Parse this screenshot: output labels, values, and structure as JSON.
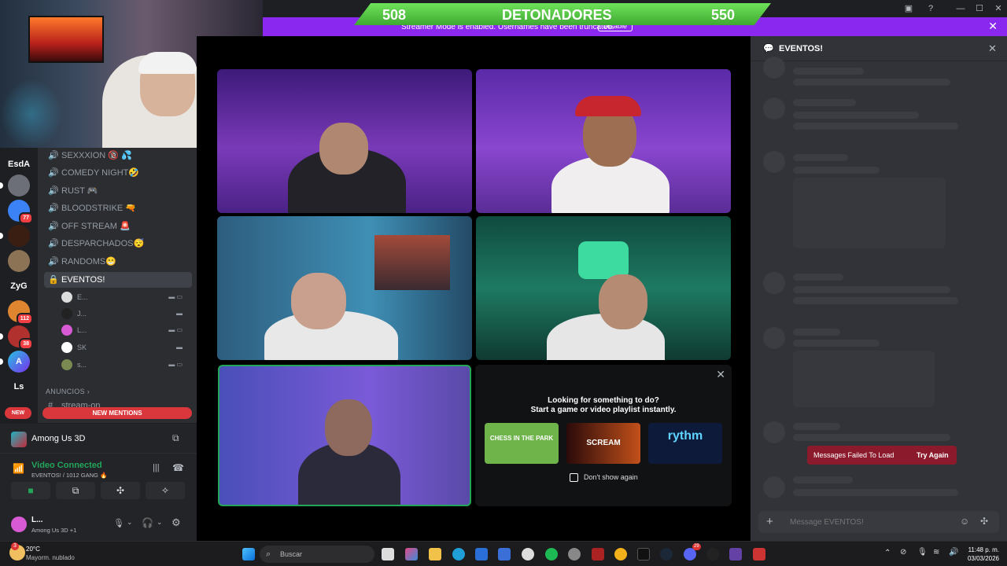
{
  "score": {
    "left": "508",
    "title": "DETONADORES",
    "right": "550"
  },
  "streamer_bar": {
    "message": "Streamer Mode is enabled. Usernames have been truncated.",
    "disable_label": "Disable"
  },
  "servers": [
    {
      "label": "EsdA"
    },
    {
      "label": "ZyG"
    },
    {
      "label": "Ls"
    }
  ],
  "server_badges": [
    "77",
    "112",
    "38"
  ],
  "channels": [
    {
      "name": "SEXXXION 🔞 💦"
    },
    {
      "name": "COMEDY NIGHT🤣"
    },
    {
      "name": "RUST 🎮"
    },
    {
      "name": "BLOODSTRIKE 🔫"
    },
    {
      "name": "OFF STREAM 🚨"
    },
    {
      "name": "DESPARCHADOS😴"
    },
    {
      "name": "RANDOMS😁"
    }
  ],
  "selected_channel": "EVENTOS!",
  "members": [
    "E...",
    "J...",
    "L...",
    "SK",
    "s..."
  ],
  "category": "ANUNCIOS",
  "next_channel_partial": "stream-on",
  "new_label": "NEW",
  "new_mentions": "NEW MENTIONS",
  "game_activity": "Among Us 3D",
  "voice": {
    "status": "Video Connected",
    "location": "EVENTOS! / 1012 GANG 🔥"
  },
  "user": {
    "name": "L...",
    "activity": "Among Us 3D +1"
  },
  "activity_panel": {
    "line1": "Looking for something to do?",
    "line2": "Start a game or video playlist instantly.",
    "dont_show": "Don't show again",
    "cards": [
      "CHESS IN THE PARK",
      "SCREAM",
      "rythm"
    ]
  },
  "chat": {
    "title": "EVENTOS!",
    "error": "Messages Failed To Load",
    "retry": "Try Again",
    "placeholder": "Message EVENTOS!"
  },
  "taskbar": {
    "temp": "20°C",
    "weather": "Mayorm. nublado",
    "weather_badge": "3",
    "search_label": "Buscar",
    "time": "11:48 p. m.",
    "date": "03/03/2026",
    "discord_badge": "29"
  },
  "colors": {
    "accent": "#8a28f0",
    "score_green": "#4cc43a",
    "voice_green": "#23a55a",
    "danger": "#da373c"
  }
}
